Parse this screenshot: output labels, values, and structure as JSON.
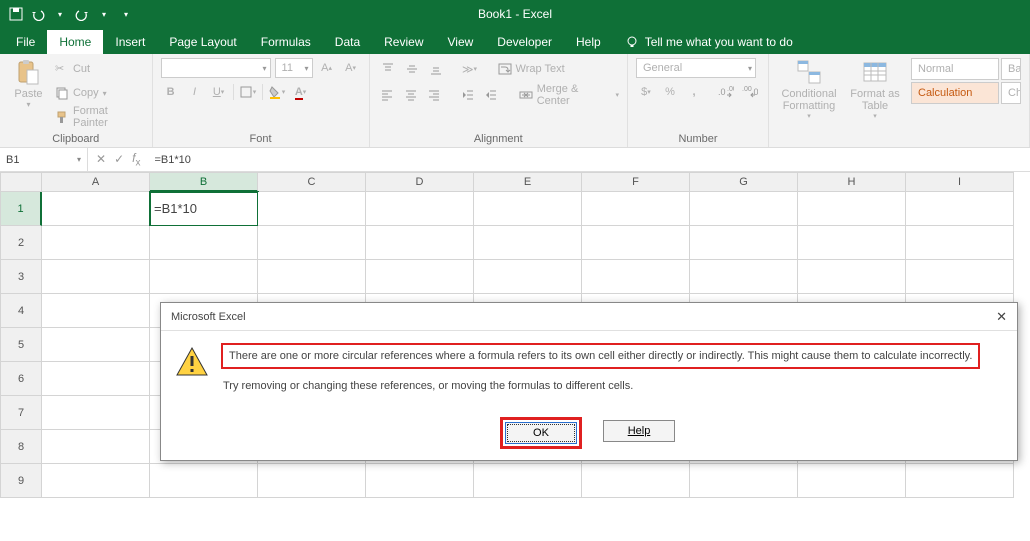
{
  "app_title": "Book1 - Excel",
  "qat": {
    "save": "save-icon",
    "undo": "undo-icon",
    "redo": "redo-icon"
  },
  "tabs": [
    "File",
    "Home",
    "Insert",
    "Page Layout",
    "Formulas",
    "Data",
    "Review",
    "View",
    "Developer",
    "Help"
  ],
  "active_tab": "Home",
  "tell_me_placeholder": "Tell me what you want to do",
  "ribbon": {
    "clipboard": {
      "label": "Clipboard",
      "paste": "Paste",
      "cut": "Cut",
      "copy": "Copy",
      "format_painter": "Format Painter"
    },
    "font": {
      "label": "Font",
      "name": "",
      "size": "11"
    },
    "alignment": {
      "label": "Alignment",
      "wrap": "Wrap Text",
      "merge": "Merge & Center"
    },
    "number": {
      "label": "Number",
      "format": "General"
    },
    "styles": {
      "cond_fmt": "Conditional Formatting",
      "fmt_table": "Format as Table",
      "normal": "Normal",
      "bad": "Ba",
      "calc": "Calculation",
      "check": "Ch"
    }
  },
  "name_box": "B1",
  "formula": "=B1*10",
  "columns": [
    "A",
    "B",
    "C",
    "D",
    "E",
    "F",
    "G",
    "H",
    "I"
  ],
  "rows_count": 9,
  "active_cell": {
    "col": "B",
    "row": 1
  },
  "cell_value": "=B1*10",
  "dialog": {
    "title": "Microsoft Excel",
    "line1": "There are one or more circular references where a formula refers to its own cell either directly or indirectly. This might cause them to calculate incorrectly.",
    "line2": "Try removing or changing these references, or moving the formulas to different cells.",
    "ok": "OK",
    "help": "Help"
  }
}
